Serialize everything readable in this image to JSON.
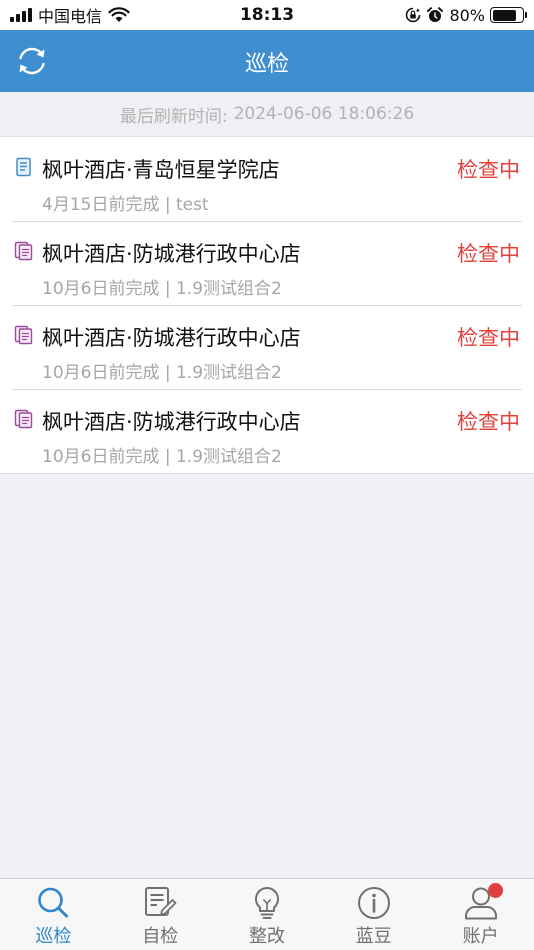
{
  "status_bar": {
    "carrier": "中国电信",
    "time": "18:13",
    "battery_percent": "80%",
    "battery_level": 0.8,
    "icons": [
      "signal-icon",
      "wifi-icon",
      "rotation-lock-icon",
      "alarm-icon",
      "battery-icon"
    ]
  },
  "nav": {
    "title": "巡检",
    "left_icon": "refresh-icon"
  },
  "refresh": {
    "label": "最后刷新时间:",
    "timestamp": "2024-06-06 18:06:26"
  },
  "list": {
    "items": [
      {
        "title": "枫叶酒店·青岛恒星学院店",
        "subtitle": "4月15日前完成 | test",
        "status": "检查中",
        "icon": "document-icon",
        "icon_color": "#3f8fd0"
      },
      {
        "title": "枫叶酒店·防城港行政中心店",
        "subtitle": "10月6日前完成 | 1.9测试组合2",
        "status": "检查中",
        "icon": "documents-icon",
        "icon_color": "#9b4a9b"
      },
      {
        "title": "枫叶酒店·防城港行政中心店",
        "subtitle": "10月6日前完成 | 1.9测试组合2",
        "status": "检查中",
        "icon": "documents-icon",
        "icon_color": "#9b4a9b"
      },
      {
        "title": "枫叶酒店·防城港行政中心店",
        "subtitle": "10月6日前完成 | 1.9测试组合2",
        "status": "检查中",
        "icon": "documents-icon",
        "icon_color": "#9b4a9b"
      }
    ]
  },
  "tabs": [
    {
      "label": "巡检",
      "icon": "search-icon",
      "active": true
    },
    {
      "label": "自检",
      "icon": "edit-document-icon",
      "active": false
    },
    {
      "label": "整改",
      "icon": "lightbulb-icon",
      "active": false
    },
    {
      "label": "蓝豆",
      "icon": "info-icon",
      "active": false
    },
    {
      "label": "账户",
      "icon": "user-icon",
      "active": false,
      "badge": true
    }
  ],
  "colors": {
    "nav_bg": "#3f8fd0",
    "status_red": "#e0433e",
    "tab_active": "#2f86cf",
    "tab_inactive": "#707070",
    "badge_red": "#e04040"
  }
}
